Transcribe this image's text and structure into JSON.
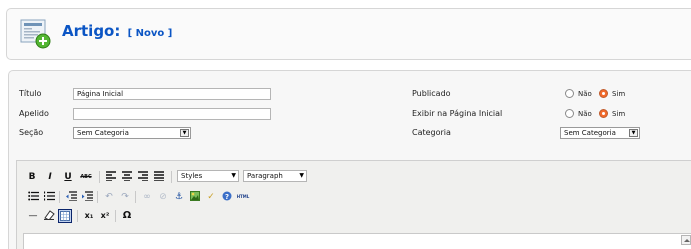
{
  "header": {
    "title": "Artigo:",
    "status": "[ Novo ]",
    "icon": "add-article-icon"
  },
  "form": {
    "titulo": {
      "label": "Título",
      "value": "Página Inicial"
    },
    "apelido": {
      "label": "Apelido",
      "value": ""
    },
    "secao": {
      "label": "Seção",
      "value": "Sem Categoria"
    },
    "publicado": {
      "label": "Publicado",
      "options": [
        "Não",
        "Sim"
      ],
      "selected": "Sim"
    },
    "exibir": {
      "label": "Exibir na Página Inicial",
      "options": [
        "Não",
        "Sim"
      ],
      "selected": "Sim"
    },
    "categoria": {
      "label": "Categoria",
      "value": "Sem Categoria"
    }
  },
  "editor": {
    "row1": {
      "bold": "B",
      "italic": "I",
      "underline": "U",
      "strike": "ABC",
      "styles": "Styles",
      "format": "Paragraph"
    },
    "row2": {
      "html": "HTML"
    },
    "row3": {
      "hr": "—",
      "subscript": "x₁",
      "superscript": "x²",
      "omega": "Ω"
    }
  },
  "colors": {
    "accent": "#0b55c4",
    "radio_checked": "#f26b2c"
  }
}
